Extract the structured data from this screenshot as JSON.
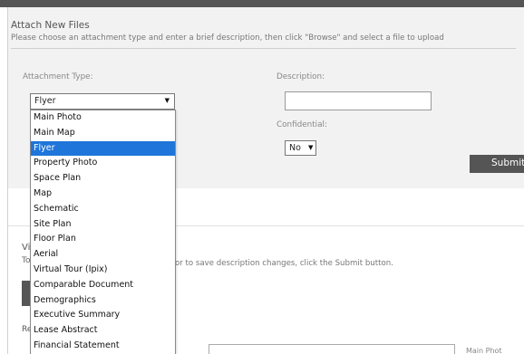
{
  "attach": {
    "title": "Attach New Files",
    "instructions": "Please choose an attachment type and enter a brief description, then click \"Browse\" and select a file to upload",
    "type_label": "Attachment Type:",
    "type_value": "Flyer",
    "description_label": "Description:",
    "description_value": "",
    "confidential_label": "Confidential:",
    "confidential_value": "No",
    "submit_label": "Submit"
  },
  "dropdown_options": [
    "Main Photo",
    "Main Map",
    "Flyer",
    "Property Photo",
    "Space Plan",
    "Map",
    "Schematic",
    "Site Plan",
    "Floor Plan",
    "Aerial",
    "Virtual Tour (Ipix)",
    "Comparable Document",
    "Demographics",
    "Executive Summary",
    "Lease Abstract",
    "Financial Statement"
  ],
  "dropdown_selected_index": 2,
  "view": {
    "title_fragment": "Vi",
    "instructions_fragment_start": "To",
    "instructions_fragment": "nts or to save description changes, click the Submit button.",
    "fragment_re": "Re",
    "fragment_t": "t",
    "fragment_main_photo": "Main Phot"
  },
  "colors": {
    "selected_highlight": "#1f75d9",
    "dark_button": "#555555",
    "panel_background": "#f2f2f2"
  }
}
